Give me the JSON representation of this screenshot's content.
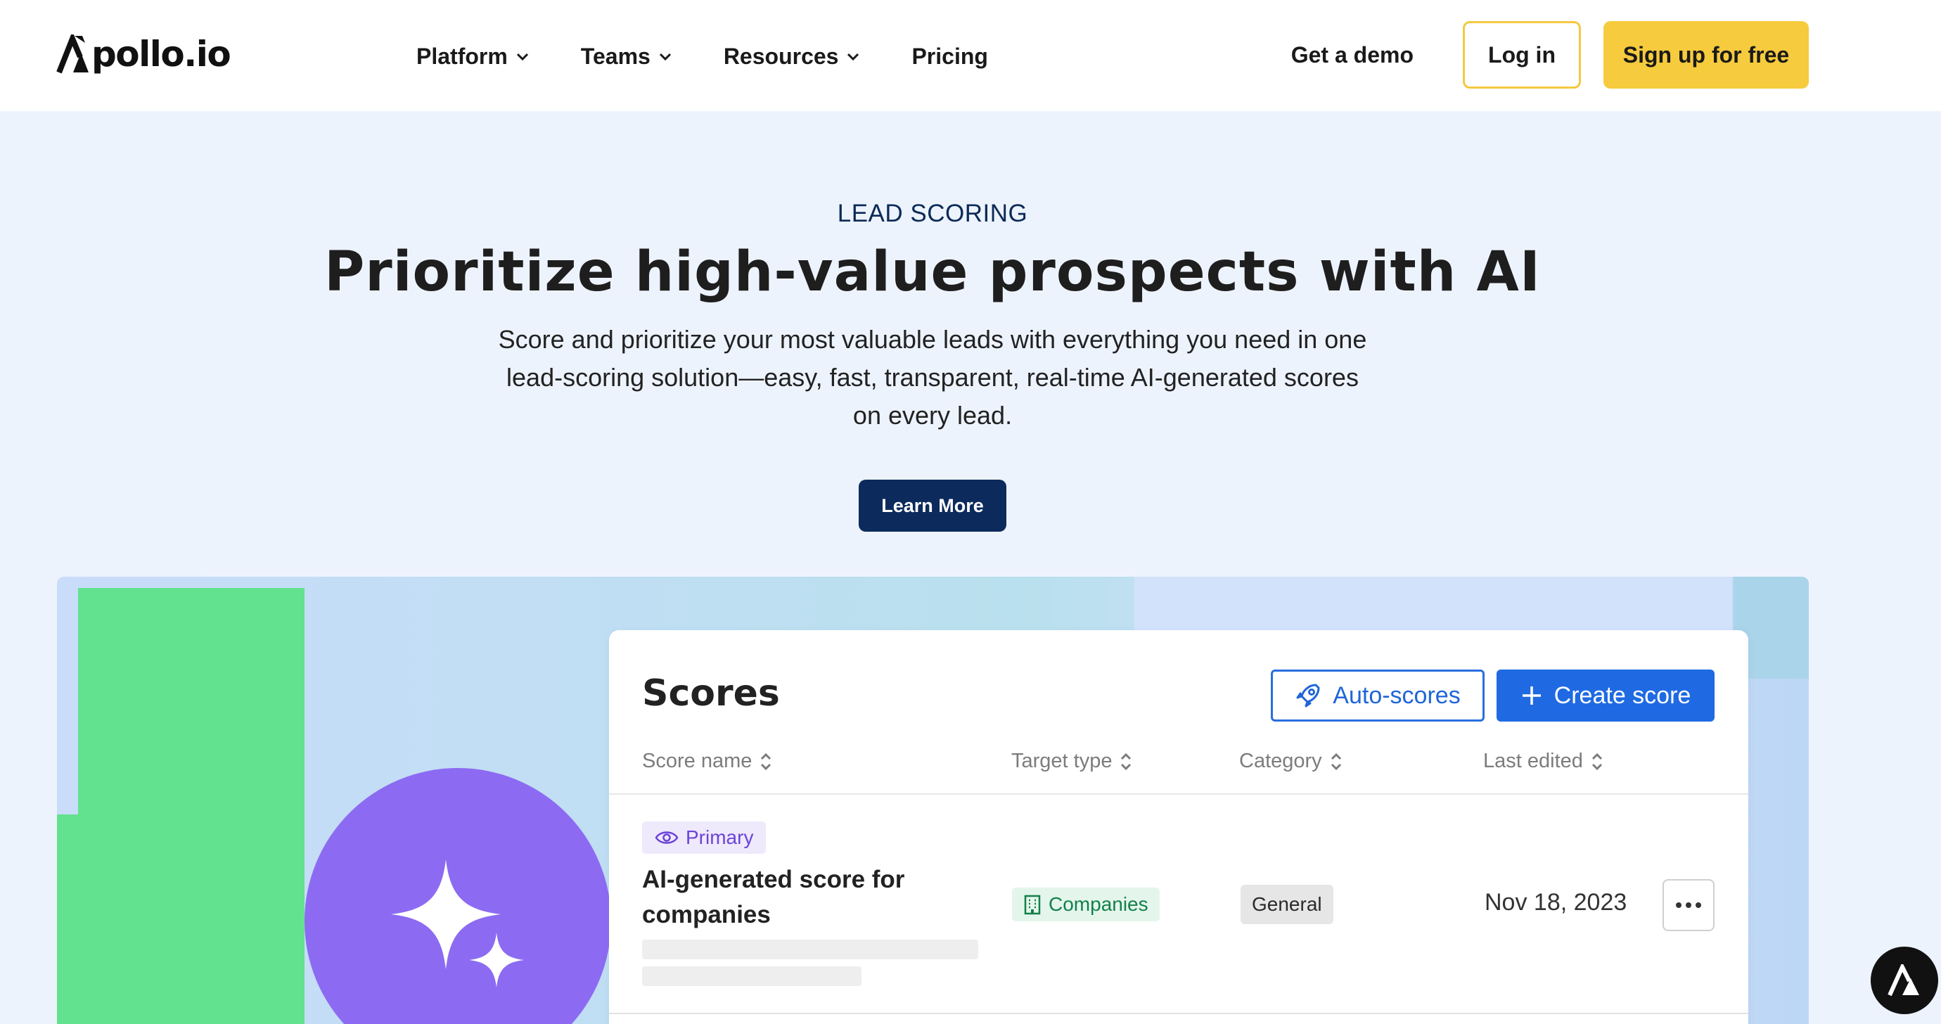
{
  "brand": {
    "logo_text": "pollo.io"
  },
  "nav": {
    "items": [
      {
        "label": "Platform"
      },
      {
        "label": "Teams"
      },
      {
        "label": "Resources"
      },
      {
        "label": "Pricing"
      }
    ],
    "get_demo": "Get a demo",
    "log_in": "Log in",
    "sign_up": "Sign up for free"
  },
  "hero": {
    "eyebrow": "LEAD SCORING",
    "title": "Prioritize high-value prospects with AI",
    "subtitle": "Score and prioritize your most valuable leads with everything you need in one lead-scoring solution—easy, fast, transparent, real-time AI-generated scores on every lead.",
    "cta": "Learn More"
  },
  "scores_card": {
    "title": "Scores",
    "auto_scores": "Auto-scores",
    "create_score": "Create score",
    "columns": [
      "Score name",
      "Target type",
      "Category",
      "Last edited"
    ],
    "row": {
      "badge": "Primary",
      "name": "AI-generated score for companies",
      "target_type": "Companies",
      "category": "General",
      "last_edited": "Nov 18, 2023"
    }
  },
  "colors": {
    "accent_yellow": "#f6cb3d",
    "navy": "#0c2a5c",
    "primary_blue": "#1f6ae3",
    "purple": "#8c6bf2",
    "green": "#62e28e"
  },
  "icons": [
    "chevron-down-icon",
    "rocket-icon",
    "plus-icon",
    "sort-icon",
    "eye-icon",
    "building-icon",
    "more-horizontal-icon",
    "sparkle-icon",
    "apollo-logo-icon"
  ]
}
